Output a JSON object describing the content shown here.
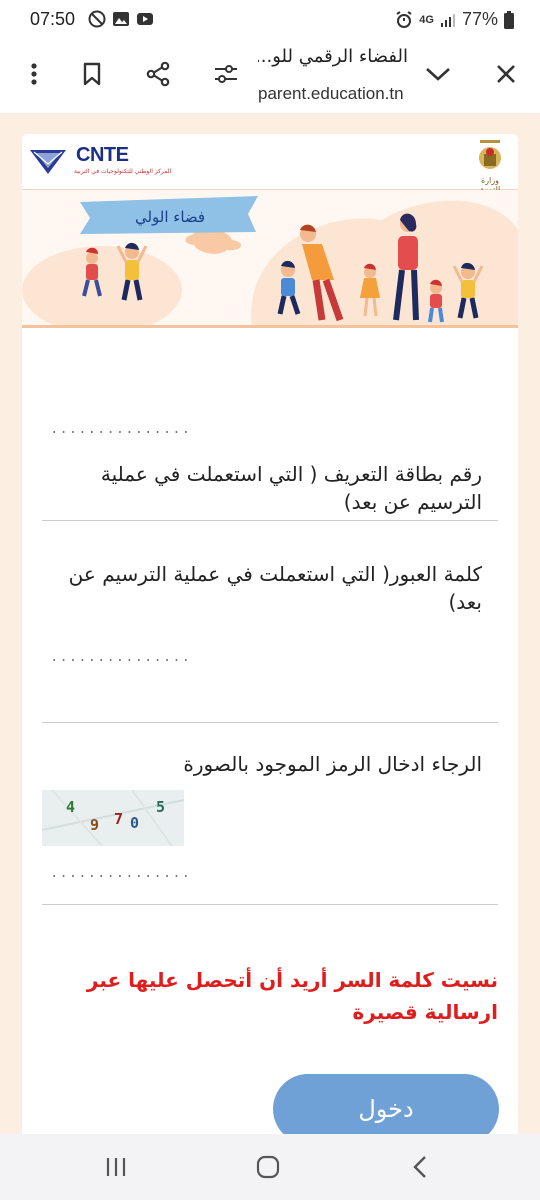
{
  "status_bar": {
    "time": "07:50",
    "network": "4G",
    "battery": "77%"
  },
  "browser": {
    "page_title": "الفضاء الرقمي للو...",
    "host": "parent.education.tn",
    "icons": [
      "more-vert-icon",
      "bookmark-icon",
      "share-icon",
      "page-settings-icon",
      "chevron-down-icon",
      "close-icon"
    ]
  },
  "header": {
    "cnte_logo_text": "CNTE",
    "cnte_subtitle": "المركز الوطني للتكنولوجيات في التربية",
    "ministry_caption": "وزارة التربية"
  },
  "banner": {
    "label": "فضاء الولي"
  },
  "form": {
    "id_field": {
      "label": "رقم بطاقة التعريف ( التي استعملت في عملية الترسيم عن بعد)",
      "value": "..............."
    },
    "password_field": {
      "label": "كلمة العبور( التي استعملت في عملية الترسيم عن بعد)",
      "value": "..............."
    },
    "captcha_field": {
      "label": "الرجاء ادخال الرمز الموجود بالصورة",
      "captcha_digits": [
        "4",
        "9",
        "7",
        "0",
        "5"
      ],
      "value": "..............."
    },
    "forgot_link": "نسيت كلمة السر أريد أن أتحصل عليها عبر ارسالية قصيرة",
    "submit_label": "دخول"
  },
  "colors": {
    "page_bg": "#fdeee2",
    "button": "#6fa1d6",
    "link_red": "#e01d1d",
    "cnte_blue": "#1b2f86"
  },
  "system_nav": {
    "icons": [
      "recent-apps-icon",
      "home-icon",
      "back-icon"
    ]
  }
}
